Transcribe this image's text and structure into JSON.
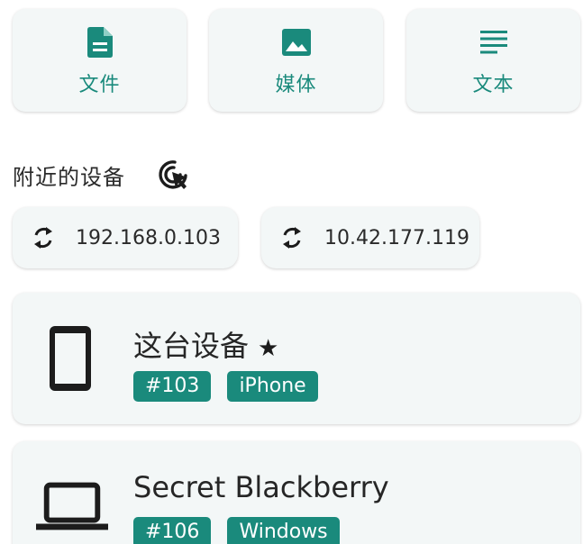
{
  "share_types": [
    {
      "label": "文件",
      "icon": "file-icon"
    },
    {
      "label": "媒体",
      "icon": "image-icon"
    },
    {
      "label": "文本",
      "icon": "text-icon"
    }
  ],
  "nearby": {
    "title": "附近的设备",
    "scan_icon": "scan-click-icon"
  },
  "ip_addresses": [
    "192.168.0.103",
    "10.42.177.119"
  ],
  "devices": [
    {
      "name": "这台设备",
      "star": "★",
      "icon": "phone-icon",
      "tags": [
        "#103",
        "iPhone"
      ]
    },
    {
      "name": "Secret Blackberry",
      "icon": "laptop-icon",
      "tags": [
        "#106",
        "Windows"
      ]
    }
  ],
  "colors": {
    "accent": "#1a8a7c",
    "card_bg": "#f3f7f7"
  }
}
